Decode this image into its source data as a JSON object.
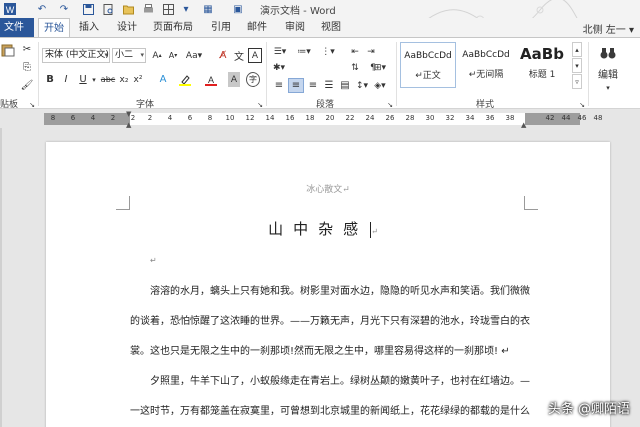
{
  "window": {
    "title": "演示文档 - Word",
    "user": "北侧 左一 ▾"
  },
  "tabs": [
    {
      "label": "文件"
    },
    {
      "label": "开始"
    },
    {
      "label": "插入"
    },
    {
      "label": "设计"
    },
    {
      "label": "页面布局"
    },
    {
      "label": "引用"
    },
    {
      "label": "邮件"
    },
    {
      "label": "审阅"
    },
    {
      "label": "视图"
    }
  ],
  "ribbon": {
    "clipboard_label": "贴板",
    "font_label": "字体",
    "paragraph_label": "段落",
    "styles_label": "样式",
    "edit_label": "编辑",
    "font_name": "宋体 (中文正文)",
    "font_size": "小二",
    "styles": [
      {
        "sample": "AaBbCcDd",
        "name": "↵正文"
      },
      {
        "sample": "AaBbCcDd",
        "name": "↵无间隔"
      },
      {
        "sample": "AaBb",
        "name": "标题 1"
      }
    ]
  },
  "ruler": {
    "numbers": [
      "8",
      "6",
      "4",
      "2",
      "2",
      "2",
      "4",
      "6",
      "8",
      "10",
      "12",
      "14",
      "16",
      "18",
      "20",
      "22",
      "24",
      "26",
      "28",
      "30",
      "32",
      "34",
      "36",
      "38",
      "42",
      "44",
      "46",
      "48"
    ]
  },
  "document": {
    "subtitle": "冰心散文↵",
    "title": "山中杂感",
    "empty_mark": "↵",
    "lines": [
      "溶溶的水月，螭头上只有她和我。树影里对面水边，隐隐的听见水声和笑语。我们微微",
      "的谈着，恐怕惊醒了这浓睡的世界。——万籁无声，月光下只有深碧的池水，玲珑雪白的衣",
      "裳。这也只是无限之生中的一刹那顷!然而无限之生中，哪里容易得这样的一刹那顷! ↵",
      "夕照里，牛羊下山了，小蚁般缘走在青岩上。绿树丛颠的嫩黄叶子，也衬在红墙边。—",
      "一这时节，万有都笼盖在寂寞里，可曾想到北京城里的新闻纸上，花花绿绿的都载的是什么"
    ]
  },
  "watermark": "头条 @卿陌语"
}
